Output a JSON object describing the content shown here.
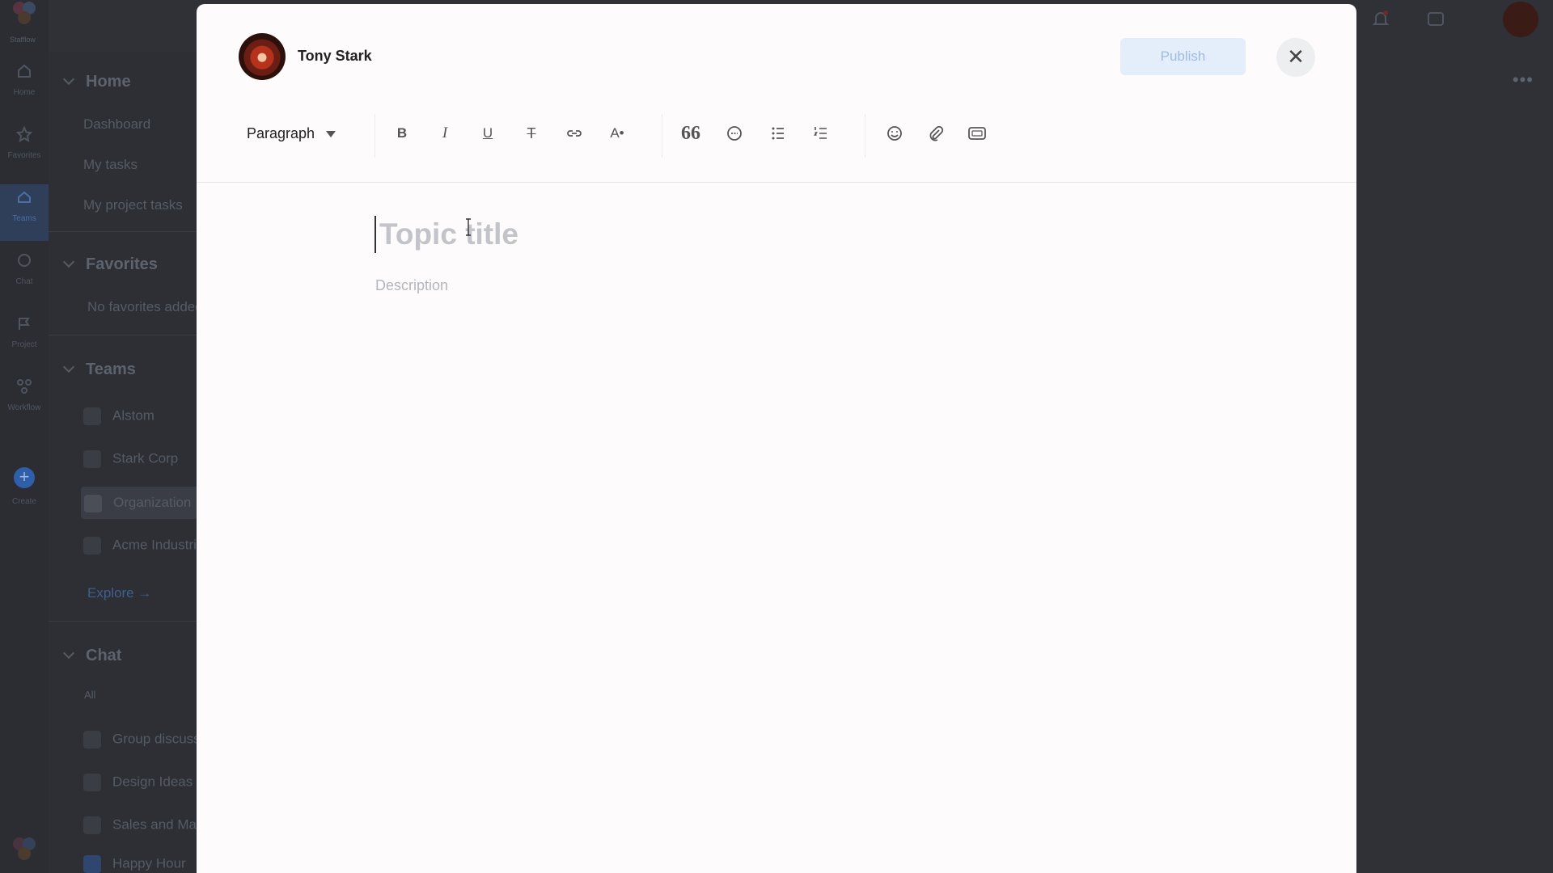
{
  "rail": {
    "logo_label": "Stafflow",
    "items": [
      {
        "label": "Home",
        "icon": "home-icon"
      },
      {
        "label": "Favorites",
        "icon": "star-icon"
      },
      {
        "label": "Teams",
        "icon": "team-icon"
      },
      {
        "label": "Chat",
        "icon": "chat-icon"
      },
      {
        "label": "Project",
        "icon": "flag-icon"
      },
      {
        "label": "Workflow",
        "icon": "workflow-icon"
      }
    ],
    "create_label": "Create"
  },
  "sidebar": {
    "home": {
      "header": "Home",
      "items": [
        "Dashboard",
        "My tasks",
        "My project tasks"
      ]
    },
    "favorites": {
      "header": "Favorites",
      "empty": "No favorites added"
    },
    "teams": {
      "header": "Teams",
      "items": [
        "Alstom",
        "Stark Corp",
        "Organization",
        "Acme Industries"
      ],
      "explore": "Explore →"
    },
    "chat": {
      "header": "Chat",
      "filter": "All",
      "items": [
        "Group discussion",
        "Design Ideas",
        "Sales and Marketing",
        "Happy Hour"
      ]
    }
  },
  "modal": {
    "author_name": "Tony Stark",
    "publish_label": "Publish",
    "close_symbol": "✕",
    "toolbar": {
      "paragraph_label": "Paragraph",
      "bold": "B",
      "italic": "I",
      "underline": "U",
      "strike": "T",
      "font_size": "A•",
      "quote": "66"
    },
    "title_placeholder": "Topic title",
    "description_placeholder": "Description"
  },
  "colors": {
    "accent_light": "#e4eefb",
    "accent_text": "#9fbbe2",
    "overlay": "#2f3137"
  }
}
